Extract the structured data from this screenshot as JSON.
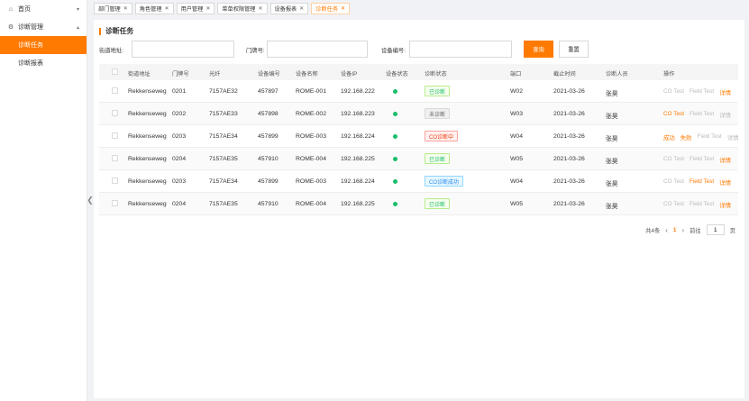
{
  "sidebar": {
    "home_label": "首页",
    "group_label": "诊断管理",
    "items": [
      {
        "label": "诊断任务",
        "active": true
      },
      {
        "label": "诊断报表",
        "active": false
      }
    ]
  },
  "tabs": [
    {
      "label": "部门管理",
      "active": false
    },
    {
      "label": "角色管理",
      "active": false
    },
    {
      "label": "用户管理",
      "active": false
    },
    {
      "label": "菜单权限管理",
      "active": false
    },
    {
      "label": "设备报表",
      "active": false
    },
    {
      "label": "诊断任务",
      "active": true
    }
  ],
  "page": {
    "title": "诊断任务"
  },
  "filters": {
    "street_label": "街道地址:",
    "street_value": "",
    "door_label": "门牌号:",
    "door_value": "",
    "device_label": "设备编号:",
    "device_value": "",
    "query_label": "查询",
    "reset_label": "重置"
  },
  "table": {
    "columns": [
      "街道地址",
      "门牌号",
      "光纤",
      "设备编号",
      "设备名称",
      "设备IP",
      "设备状态",
      "诊断状态",
      "端口",
      "截止时间",
      "诊断人员",
      "操作"
    ],
    "rows": [
      {
        "street": "Rekkenseweg",
        "door": "0201",
        "fiber": "7157AE32",
        "device_no": "457897",
        "device_name": "ROME-001",
        "ip": "192.168.222",
        "diag": "已诊断",
        "diag_type": "green",
        "port": "W02",
        "deadline": "2021-03-26",
        "person": "张昊",
        "ops": [
          {
            "label": "CO Test",
            "color": "gray"
          },
          {
            "label": "Field Test",
            "color": "gray"
          },
          {
            "label": "详情",
            "color": "orange"
          }
        ]
      },
      {
        "street": "Rekkenseweg",
        "door": "0202",
        "fiber": "7157AE33",
        "device_no": "457898",
        "device_name": "ROME-002",
        "ip": "192.168.223",
        "diag": "未诊断",
        "diag_type": "gray",
        "port": "W03",
        "deadline": "2021-03-26",
        "person": "张昊",
        "ops": [
          {
            "label": "CO Test",
            "color": "orange"
          },
          {
            "label": "Field Test",
            "color": "gray"
          },
          {
            "label": "详情",
            "color": "gray"
          }
        ]
      },
      {
        "street": "Rekkenseweg",
        "door": "0203",
        "fiber": "7157AE34",
        "device_no": "457899",
        "device_name": "ROME-003",
        "ip": "192.168.224",
        "diag": "CO诊断中",
        "diag_type": "red",
        "port": "W04",
        "deadline": "2021-03-26",
        "person": "张昊",
        "ops": [
          {
            "label": "成功",
            "color": "orange"
          },
          {
            "label": "失败",
            "color": "orange"
          },
          {
            "label": "Field Test",
            "color": "gray"
          },
          {
            "label": "详情",
            "color": "gray"
          }
        ]
      },
      {
        "street": "Rekkenseweg",
        "door": "0204",
        "fiber": "7157AE35",
        "device_no": "457910",
        "device_name": "ROME-004",
        "ip": "192.168.225",
        "diag": "已诊断",
        "diag_type": "green",
        "port": "W05",
        "deadline": "2021-03-26",
        "person": "张昊",
        "ops": [
          {
            "label": "CO Test",
            "color": "gray"
          },
          {
            "label": "Field Test",
            "color": "gray"
          },
          {
            "label": "详情",
            "color": "orange"
          }
        ]
      },
      {
        "street": "Rekkenseweg",
        "door": "0203",
        "fiber": "7157AE34",
        "device_no": "457899",
        "device_name": "ROME-003",
        "ip": "192.168.224",
        "diag": "CO诊断成功",
        "diag_type": "blue",
        "port": "W04",
        "deadline": "2021-03-26",
        "person": "张昊",
        "ops": [
          {
            "label": "CO Test",
            "color": "gray"
          },
          {
            "label": "Field Test",
            "color": "orange"
          },
          {
            "label": "详情",
            "color": "orange"
          }
        ]
      },
      {
        "street": "Rekkenseweg",
        "door": "0204",
        "fiber": "7157AE35",
        "device_no": "457910",
        "device_name": "ROME-004",
        "ip": "192.168.225",
        "diag": "已诊断",
        "diag_type": "green",
        "port": "W05",
        "deadline": "2021-03-26",
        "person": "张昊",
        "ops": [
          {
            "label": "CO Test",
            "color": "gray"
          },
          {
            "label": "Field Test",
            "color": "gray"
          },
          {
            "label": "详情",
            "color": "orange"
          }
        ]
      }
    ]
  },
  "pagination": {
    "total_label": "共4条",
    "current_page": "1",
    "goto_label": "前往",
    "goto_value": "1",
    "page_unit": "页"
  },
  "colors": {
    "accent": "#ff7a00",
    "status_online": "#19be6b"
  }
}
